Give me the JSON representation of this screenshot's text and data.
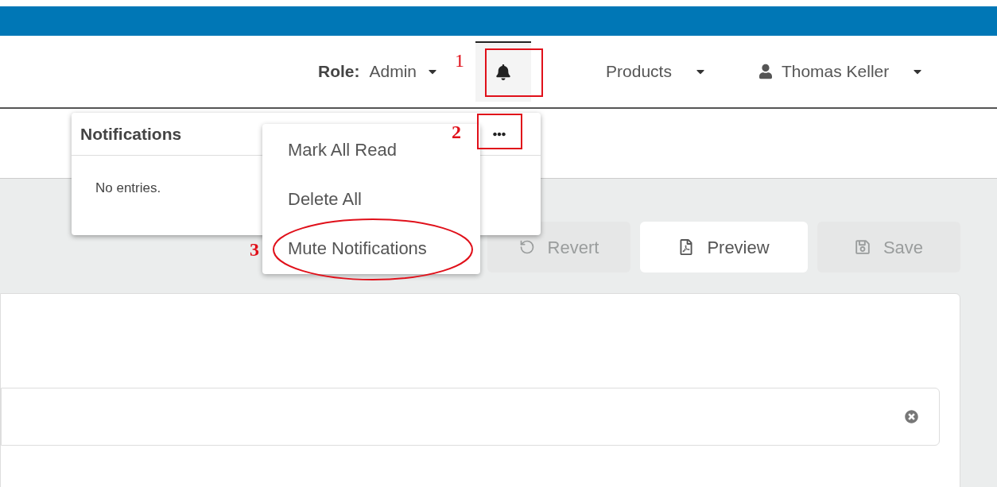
{
  "header": {
    "role_label": "Role:",
    "role_value": "Admin",
    "notifications_button": {
      "active": true
    },
    "products_menu": "Products",
    "user_menu": "Thomas Keller"
  },
  "notifications_panel": {
    "title": "Notifications",
    "empty_text": "No entries."
  },
  "more_menu": {
    "items": [
      {
        "label": "Mark All Read"
      },
      {
        "label": "Delete All"
      },
      {
        "label": "Mute Notifications"
      }
    ]
  },
  "toolbar": {
    "buttons": [
      {
        "kind": "revert",
        "label": "Revert",
        "disabled": true
      },
      {
        "kind": "preview",
        "label": "Preview",
        "disabled": false
      },
      {
        "kind": "save",
        "label": "Save",
        "disabled": true
      }
    ]
  },
  "annotations": [
    {
      "label": "1"
    },
    {
      "label": "2"
    },
    {
      "label": "3"
    }
  ]
}
